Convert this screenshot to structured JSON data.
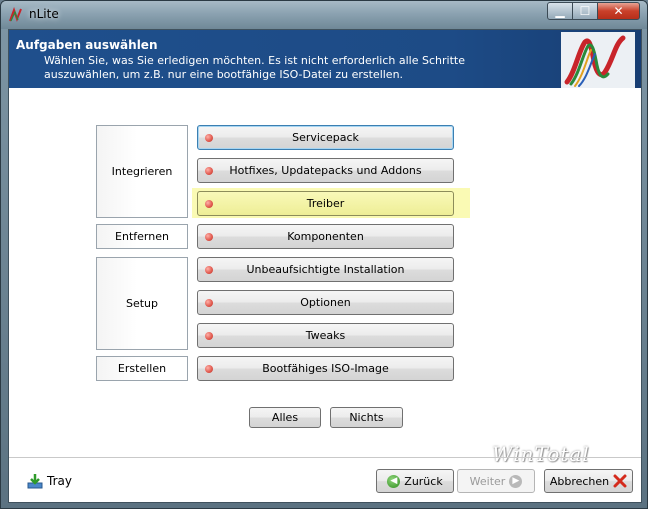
{
  "window": {
    "title": "nLite"
  },
  "header": {
    "title": "Aufgaben auswählen",
    "description": "Wählen Sie, was Sie erledigen möchten. Es ist nicht erforderlich alle Schritte auszuwählen, um z.B. nur eine bootfähige ISO-Datei zu erstellen."
  },
  "groups": {
    "integrieren": "Integrieren",
    "entfernen": "Entfernen",
    "setup": "Setup",
    "erstellen": "Erstellen"
  },
  "tasks": {
    "servicepack": "Servicepack",
    "hotfixes": "Hotfixes, Updatepacks und Addons",
    "treiber": "Treiber",
    "komponenten": "Komponenten",
    "unbeaufsichtigt": "Unbeaufsichtigte Installation",
    "optionen": "Optionen",
    "tweaks": "Tweaks",
    "iso": "Bootfähiges ISO-Image"
  },
  "selection": {
    "alles": "Alles",
    "nichts": "Nichts"
  },
  "watermark": "WinTotal",
  "footer": {
    "tray": "Tray",
    "back": "Zurück",
    "next": "Weiter",
    "cancel": "Abbrechen"
  },
  "colors": {
    "header_bg": "#1f4f8c",
    "highlight": "#fafab4",
    "status_dot": "#e0574c"
  },
  "icons": {
    "app": "nlite-icon",
    "tray": "tray-download-icon",
    "back": "arrow-left-icon",
    "next": "arrow-right-icon",
    "cancel": "red-x-icon"
  }
}
